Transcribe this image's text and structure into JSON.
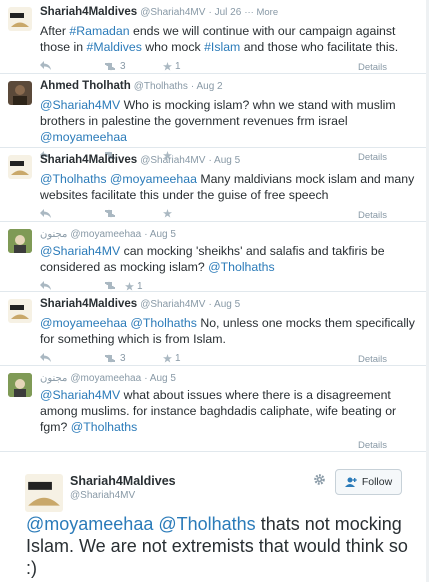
{
  "tweets": [
    {
      "name": "Shariah4Maldives",
      "handle": "@Shariah4MV",
      "date": "· Jul 26",
      "more": "··· More",
      "text": [
        {
          "t": "After ",
          "link": false
        },
        {
          "t": "#Ramadan",
          "link": true
        },
        {
          "t": " ends we will continue with our campaign against those in ",
          "link": false
        },
        {
          "t": "#Maldives",
          "link": true
        },
        {
          "t": " who mock ",
          "link": false
        },
        {
          "t": "#Islam",
          "link": true
        },
        {
          "t": " and those who facilitate this.",
          "link": false
        }
      ],
      "retweets": "3",
      "favorites": "1",
      "details": "Details"
    },
    {
      "name": "Ahmed Tholhath",
      "handle": "@Tholhaths",
      "date": "· Aug 2",
      "text": [
        {
          "t": "@Shariah4MV",
          "link": true
        },
        {
          "t": " Who is mocking islam? whn we stand with muslim brothers in palestine the government revenues frm israel ",
          "link": false
        },
        {
          "t": "@moyameehaa",
          "link": true
        }
      ],
      "retweets": "",
      "favorites": "",
      "details": "Details"
    },
    {
      "name": "Shariah4Maldives",
      "handle": "@Shariah4MV",
      "date": "· Aug 5",
      "text": [
        {
          "t": "@Tholhaths",
          "link": true
        },
        {
          "t": " ",
          "link": false
        },
        {
          "t": "@moyameehaa",
          "link": true
        },
        {
          "t": " Many maldivians mock islam and many websites facilitate this under the guise of free speech",
          "link": false
        }
      ],
      "retweets": "",
      "favorites": "",
      "details": "Details"
    },
    {
      "name": "مجنون",
      "handle": "@moyameehaa",
      "date": "· Aug 5",
      "text": [
        {
          "t": "@Shariah4MV",
          "link": true
        },
        {
          "t": " can mocking 'sheikhs' and salafis and takfiris be considered as mocking islam? ",
          "link": false
        },
        {
          "t": "@Tholhaths",
          "link": true
        }
      ],
      "retweets": "",
      "favorites": "1",
      "details": ""
    },
    {
      "name": "Shariah4Maldives",
      "handle": "@Shariah4MV",
      "date": "· Aug 5",
      "text": [
        {
          "t": "@moyameehaa",
          "link": true
        },
        {
          "t": " ",
          "link": false
        },
        {
          "t": "@Tholhaths",
          "link": true
        },
        {
          "t": " No, unless one mocks them specifically for something which is from Islam.",
          "link": false
        }
      ],
      "retweets": "3",
      "favorites": "1",
      "details": "Details"
    },
    {
      "name": "مجنون",
      "handle": "@moyameehaa",
      "date": "· Aug 5",
      "text": [
        {
          "t": "@Shariah4MV",
          "link": true
        },
        {
          "t": " what about issues where there is a disagreement among muslims. for instance baghdadis caliphate, wife beating or fgm? ",
          "link": false
        },
        {
          "t": "@Tholhaths",
          "link": true
        }
      ],
      "retweets": "",
      "favorites": "",
      "details": "Details"
    }
  ],
  "main": {
    "name": "Shariah4Maldives",
    "handle": "@Shariah4MV",
    "follow_label": "Follow",
    "text": [
      {
        "t": "@moyameehaa",
        "link": true
      },
      {
        "t": " ",
        "link": false
      },
      {
        "t": "@Tholhaths",
        "link": true
      },
      {
        "t": " thats not mocking Islam. We are not extremists that would think so :)",
        "link": false
      }
    ]
  },
  "colors": {
    "link": "#2b7bb9",
    "muted": "#8899a6",
    "text": "#292f33"
  }
}
